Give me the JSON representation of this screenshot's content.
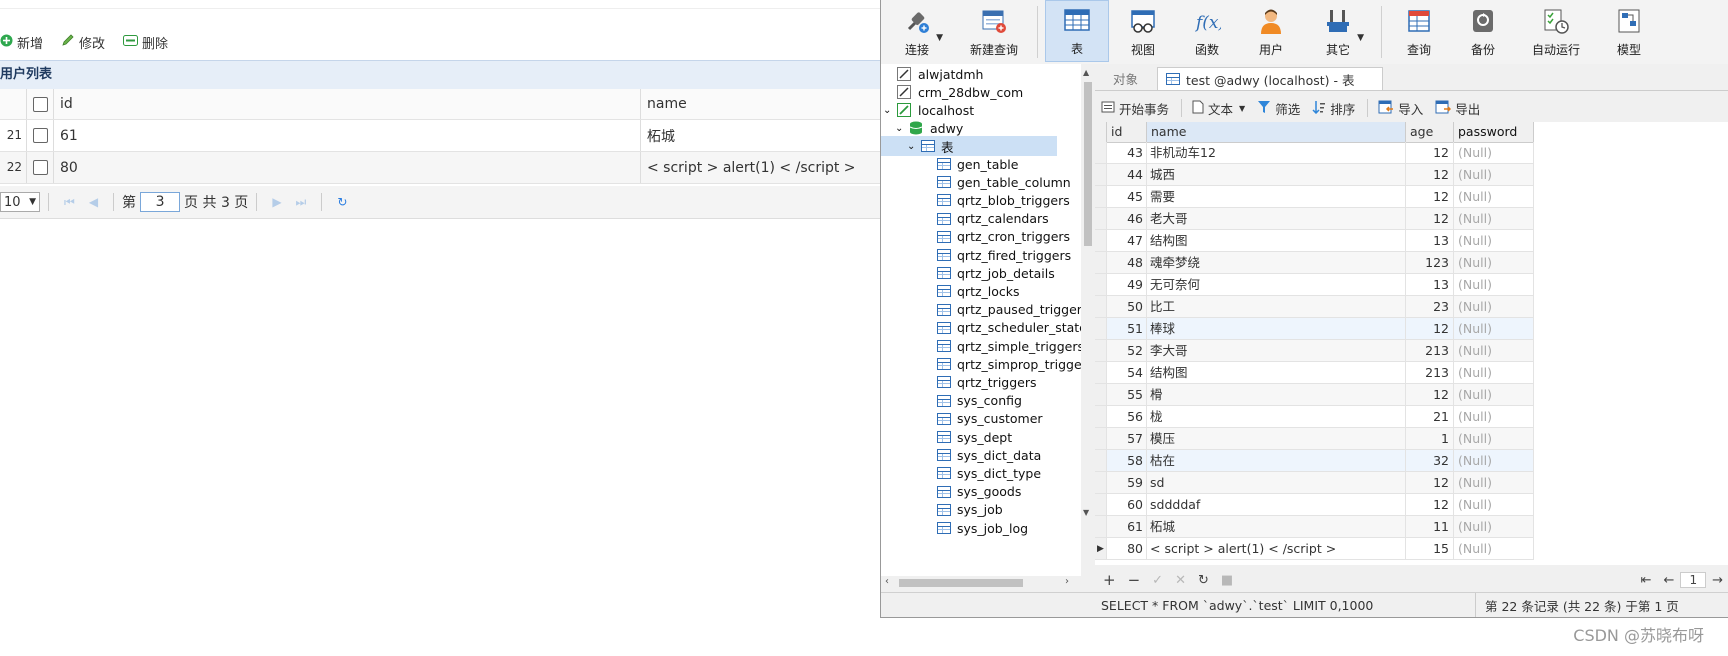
{
  "web": {
    "toolbar": {
      "add": "新增",
      "edit": "修改",
      "delete": "删除"
    },
    "panel_title": "用户列表",
    "columns": {
      "id": "id",
      "name": "name"
    },
    "rows": [
      {
        "rownum": "21",
        "id": "61",
        "name": "柘城"
      },
      {
        "rownum": "22",
        "id": "80",
        "name": "< script > alert(1) < /script >"
      }
    ],
    "pager": {
      "page_size": "10",
      "page_prefix": "第",
      "page_value": "3",
      "page_suffix": "页 共 3 页"
    }
  },
  "navicat": {
    "ribbon": [
      {
        "id": "connect",
        "label": "连接"
      },
      {
        "id": "new-query",
        "label": "新建查询"
      },
      {
        "id": "table",
        "label": "表"
      },
      {
        "id": "view",
        "label": "视图"
      },
      {
        "id": "function",
        "label": "函数"
      },
      {
        "id": "user",
        "label": "用户"
      },
      {
        "id": "other",
        "label": "其它"
      },
      {
        "id": "query",
        "label": "查询"
      },
      {
        "id": "backup",
        "label": "备份"
      },
      {
        "id": "automation",
        "label": "自动运行"
      },
      {
        "id": "model",
        "label": "模型"
      }
    ],
    "tree": {
      "connections": [
        "alwjatdmh",
        "crm_28dbw_com",
        "localhost"
      ],
      "database": "adwy",
      "folder": "表",
      "tables": [
        "gen_table",
        "gen_table_column",
        "qrtz_blob_triggers",
        "qrtz_calendars",
        "qrtz_cron_triggers",
        "qrtz_fired_triggers",
        "qrtz_job_details",
        "qrtz_locks",
        "qrtz_paused_trigger",
        "qrtz_scheduler_state",
        "qrtz_simple_triggers",
        "qrtz_simprop_trigge",
        "qrtz_triggers",
        "sys_config",
        "sys_customer",
        "sys_dept",
        "sys_dict_data",
        "sys_dict_type",
        "sys_goods",
        "sys_job",
        "sys_job_log"
      ]
    },
    "tabs": {
      "objects": "对象",
      "active": "test @adwy (localhost) - 表"
    },
    "data_toolbar": {
      "begin": "开始事务",
      "text": "文本",
      "filter": "筛选",
      "sort": "排序",
      "import": "导入",
      "export": "导出"
    },
    "grid_columns": [
      "id",
      "name",
      "age",
      "password"
    ],
    "grid_rows": [
      {
        "id": "43",
        "name": "非机动车12",
        "age": "12",
        "password": "(Null)"
      },
      {
        "id": "44",
        "name": "城西",
        "age": "12",
        "password": "(Null)"
      },
      {
        "id": "45",
        "name": "需要",
        "age": "12",
        "password": "(Null)"
      },
      {
        "id": "46",
        "name": "老大哥",
        "age": "12",
        "password": "(Null)"
      },
      {
        "id": "47",
        "name": "结构图",
        "age": "13",
        "password": "(Null)"
      },
      {
        "id": "48",
        "name": "魂牵梦绕",
        "age": "123",
        "password": "(Null)"
      },
      {
        "id": "49",
        "name": "无可奈何",
        "age": "13",
        "password": "(Null)"
      },
      {
        "id": "50",
        "name": "比工",
        "age": "23",
        "password": "(Null)"
      },
      {
        "id": "51",
        "name": "棒球",
        "age": "12",
        "password": "(Null)"
      },
      {
        "id": "52",
        "name": "李大哥",
        "age": "213",
        "password": "(Null)"
      },
      {
        "id": "54",
        "name": "结构图",
        "age": "213",
        "password": "(Null)"
      },
      {
        "id": "55",
        "name": "榾",
        "age": "12",
        "password": "(Null)"
      },
      {
        "id": "56",
        "name": "栊",
        "age": "21",
        "password": "(Null)"
      },
      {
        "id": "57",
        "name": "模压",
        "age": "1",
        "password": "(Null)"
      },
      {
        "id": "58",
        "name": "枯在",
        "age": "32",
        "password": "(Null)"
      },
      {
        "id": "59",
        "name": "sd",
        "age": "12",
        "password": "(Null)"
      },
      {
        "id": "60",
        "name": "sddddaf",
        "age": "12",
        "password": "(Null)"
      },
      {
        "id": "61",
        "name": "柘城",
        "age": "11",
        "password": "(Null)"
      },
      {
        "id": "80",
        "name": "< script > alert(1) < /script >",
        "age": "15",
        "password": "(Null)"
      }
    ],
    "footer_page": "1",
    "status_sql": "SELECT * FROM `adwy`.`test` LIMIT 0,1000",
    "status_right": "第 22 条记录 (共 22 条) 于第 1 页"
  },
  "watermark": "CSDN @苏晓布呀",
  "colors": {
    "accent": "#2a7de1",
    "null_text": "#a8a8a8",
    "ribbon_active": "#d3e3f5"
  }
}
